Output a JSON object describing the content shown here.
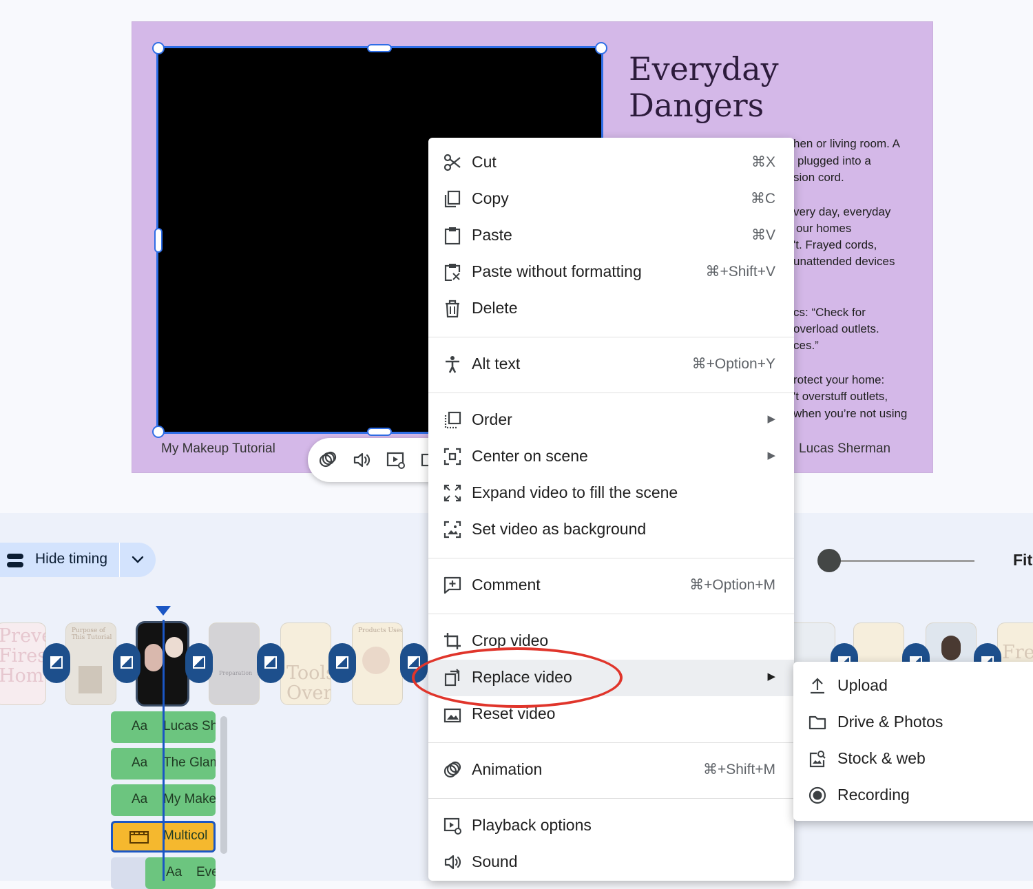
{
  "slide": {
    "title_line1": "Everyday",
    "title_line2": "Dangers",
    "body_fragments": [
      "hen or living room. A",
      "plugged into a",
      "sion cord.",
      "very day, everyday",
      "our homes",
      "'t. Frayed cords,",
      "unattended devices",
      "cs: “Check for",
      "overload outlets.",
      "ces.”",
      "rotect your home:",
      "'t overstuff outlets,",
      "when you’re not using"
    ],
    "footer_left": "My Makeup Tutorial",
    "footer_right": "Lucas Sherman"
  },
  "toolbar": {
    "icons": [
      "animation-icon",
      "sound-icon",
      "playback-options-icon"
    ]
  },
  "timeline": {
    "hide_timing_label": "Hide timing",
    "fit_label": "Fit",
    "zoom_level": 0.0,
    "scenes": [
      {
        "text": "Preve\nFires\nHom"
      },
      {
        "text": "Purpose of\nThis Tutorial"
      },
      {
        "text": ""
      },
      {
        "text": "Preparation"
      },
      {
        "text": "Tools\nOver"
      },
      {
        "text": "Products Used"
      },
      {
        "text": ""
      },
      {
        "text": ""
      },
      {
        "text": ""
      },
      {
        "text": "Fre"
      }
    ],
    "tracks": [
      {
        "aa": "Aa",
        "label": "Lucas Sh"
      },
      {
        "aa": "Aa",
        "label": "The Glam"
      },
      {
        "aa": "Aa",
        "label": "My Make"
      },
      {
        "aa": "",
        "label": "Multicol"
      },
      {
        "aa": "Aa",
        "label": "Eve"
      }
    ]
  },
  "context_menu": {
    "items": [
      {
        "label": "Cut",
        "shortcut": "⌘X"
      },
      {
        "label": "Copy",
        "shortcut": "⌘C"
      },
      {
        "label": "Paste",
        "shortcut": "⌘V"
      },
      {
        "label": "Paste without formatting",
        "shortcut": "⌘+Shift+V"
      },
      {
        "label": "Delete",
        "shortcut": ""
      },
      {
        "label": "Alt text",
        "shortcut": "⌘+Option+Y"
      },
      {
        "label": "Order",
        "shortcut": ""
      },
      {
        "label": "Center on scene",
        "shortcut": ""
      },
      {
        "label": "Expand video to fill the scene",
        "shortcut": ""
      },
      {
        "label": "Set video as background",
        "shortcut": ""
      },
      {
        "label": "Comment",
        "shortcut": "⌘+Option+M"
      },
      {
        "label": "Crop video",
        "shortcut": ""
      },
      {
        "label": "Replace video",
        "shortcut": ""
      },
      {
        "label": "Reset video",
        "shortcut": ""
      },
      {
        "label": "Animation",
        "shortcut": "⌘+Shift+M"
      },
      {
        "label": "Playback options",
        "shortcut": ""
      },
      {
        "label": "Sound",
        "shortcut": ""
      }
    ],
    "submenu_arrow": "▶"
  },
  "submenu": {
    "items": [
      {
        "label": "Upload"
      },
      {
        "label": "Drive & Photos"
      },
      {
        "label": "Stock & web"
      },
      {
        "label": "Recording"
      }
    ]
  },
  "colors": {
    "slide_bg": "#d4b8e8",
    "selection": "#2f6ee6",
    "highlight_oval": "#e0352b",
    "track_green": "#6cc57f",
    "track_yellow": "#f5b82e",
    "transition": "#1d4f8c"
  }
}
